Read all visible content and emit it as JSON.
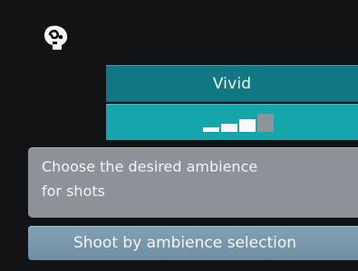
{
  "mode": {
    "icon": "ambience-mode-icon"
  },
  "ambience": {
    "selected": "Vivid",
    "level": 3,
    "level_max": 4,
    "header_color": "#0f7883",
    "level_color": "#14a6aa"
  },
  "info": {
    "line1": "Choose the desired ambience",
    "line2": "for shots"
  },
  "footer": {
    "label": "Shoot by ambience selection"
  }
}
